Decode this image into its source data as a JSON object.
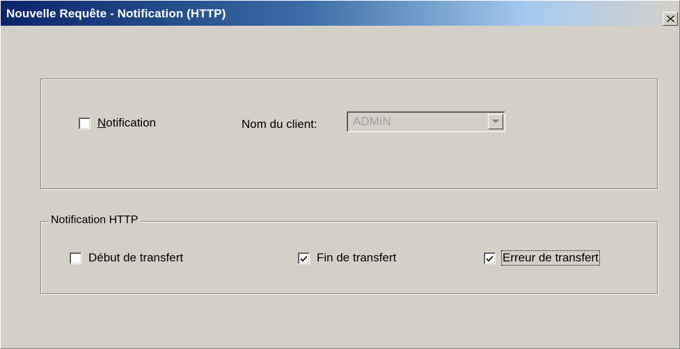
{
  "window": {
    "title": "Nouvelle Requête - Notification (HTTP)",
    "close_icon": "close-icon"
  },
  "notification_section": {
    "checkbox_label": "Notification",
    "checked": false,
    "client_label": "Nom du client:",
    "client_value": "ADMIN",
    "client_enabled": false
  },
  "http_group": {
    "legend": "Notification HTTP",
    "options": [
      {
        "label": "Début de transfert",
        "checked": false
      },
      {
        "label": "Fin de transfert",
        "checked": true
      },
      {
        "label": "Erreur de transfert",
        "checked": true,
        "focused": true
      }
    ]
  },
  "colors": {
    "title_gradient_start": "#0a246a",
    "title_gradient_end": "#a6caf0",
    "dialog_face": "#d4d0c8",
    "disabled_text": "#a0a0a0"
  }
}
